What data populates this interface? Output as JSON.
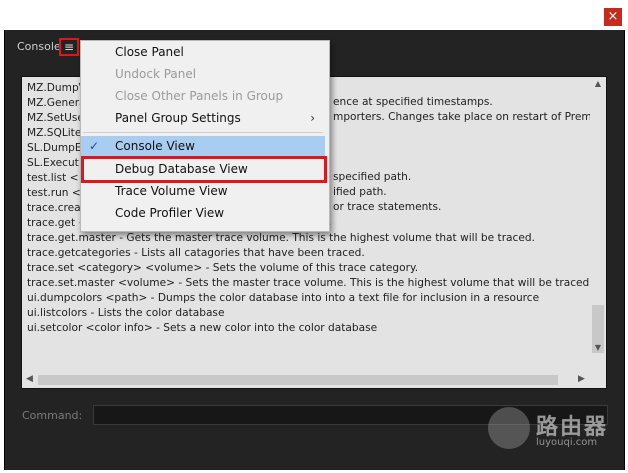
{
  "window": {
    "close_glyph": "×"
  },
  "panel": {
    "label": "Console",
    "menu_glyph": "≡"
  },
  "console": {
    "lines": [
      "MZ.DumpV",
      "MZ.Genera",
      "MZ.SetUse",
      "MZ.SQLiteT",
      "SL.DumpEx",
      "SL.Execut",
      "test.list <",
      "test.run <t",
      "trace.creat",
      "trace.get <",
      "trace.get.master - Gets the master trace volume. This is the highest volume that will be traced.",
      "trace.getcategories - Lists all catagories that have been traced.",
      "trace.set <category> <volume> - Sets the volume of this trace category.",
      "trace.set.master <volume> - Sets the master trace volume. This is the highest volume that will be traced.",
      "ui.dumpcolors <path> - Dumps the color database into into a text file for inclusion in a resource",
      "ui.listcolors - Lists the color database",
      "ui.setcolor <color info> - Sets a new color into the color database"
    ],
    "partial_right_text": [
      "ence at specified timestamps.",
      "mporters. Changes take place on restart of Premiere",
      "specified path.",
      "ified path.",
      "or trace statements.",
      "."
    ]
  },
  "menu": {
    "items": [
      {
        "label": "Close Panel",
        "state": "enabled"
      },
      {
        "label": "Undock Panel",
        "state": "disabled"
      },
      {
        "label": "Close Other Panels in Group",
        "state": "disabled"
      },
      {
        "label": "Panel Group Settings",
        "state": "enabled",
        "submenu_glyph": "›"
      },
      {
        "label": "Console View",
        "state": "checked",
        "check_glyph": "✓"
      },
      {
        "label": "Debug Database View",
        "state": "enabled"
      },
      {
        "label": "Trace Volume View",
        "state": "enabled"
      },
      {
        "label": "Code Profiler View",
        "state": "enabled"
      }
    ]
  },
  "command": {
    "label": "Command:"
  },
  "watermark": {
    "brand": "路由器",
    "url": "luyouqi.com"
  },
  "colors": {
    "highlight": "#e0161d",
    "selected": "#a9cdf1",
    "panel_bg": "#232323",
    "console_bg": "#e3e3e3"
  }
}
